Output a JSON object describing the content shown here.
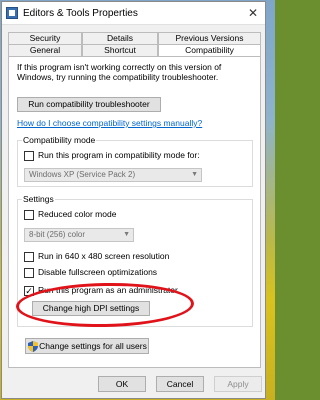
{
  "window": {
    "title": "Editors & Tools Properties",
    "close": "✕"
  },
  "tabs": {
    "row1": [
      "Security",
      "Details",
      "Previous Versions"
    ],
    "row2": [
      "General",
      "Shortcut",
      "Compatibility"
    ]
  },
  "intro_text": "If this program isn't working correctly on this version of Windows, try running the compatibility troubleshooter.",
  "troubleshooter_button": "Run compatibility troubleshooter",
  "manual_link": "How do I choose compatibility settings manually?",
  "compat_mode": {
    "title": "Compatibility mode",
    "checkbox_label": "Run this program in compatibility mode for:",
    "select_value": "Windows XP (Service Pack 2)"
  },
  "settings": {
    "title": "Settings",
    "reduced_color_label": "Reduced color mode",
    "color_select_value": "8-bit (256) color",
    "run_640_label": "Run in 640 x 480 screen resolution",
    "disable_fullscreen_label": "Disable fullscreen optimizations",
    "run_admin_label": "Run this program as an administrator",
    "run_admin_checked": "✓",
    "dpi_button": "Change high DPI settings"
  },
  "all_users_button": "Change settings for all users",
  "footer": {
    "ok": "OK",
    "cancel": "Cancel",
    "apply": "Apply"
  },
  "colors": {
    "highlight_ellipse": "#e0131a",
    "link": "#0066cc"
  }
}
